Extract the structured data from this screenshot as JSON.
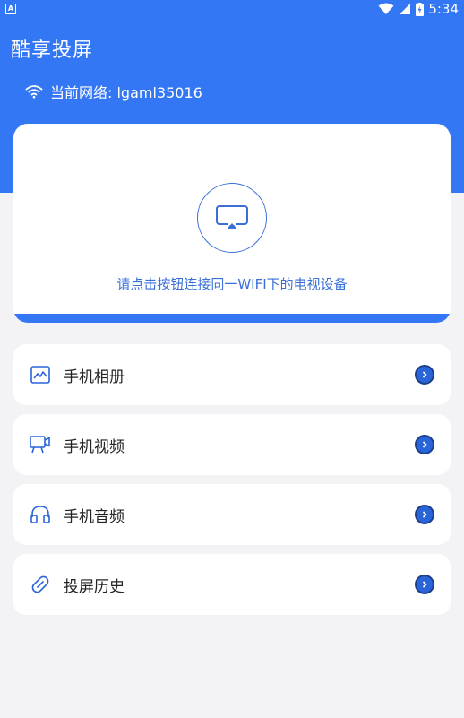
{
  "status_bar": {
    "notification_icon": "A",
    "time": "5:34",
    "icons": [
      "wifi-signal-icon",
      "cell-signal-icon",
      "battery-charging-icon"
    ]
  },
  "app": {
    "title": "酷享投屏"
  },
  "network": {
    "icon": "wifi-icon",
    "label": "当前网络: lgaml35016"
  },
  "cast_card": {
    "button_icon": "screen-cast-icon",
    "hint": "请点击按钮连接同一WIFI下的电视设备"
  },
  "menu": [
    {
      "icon": "photo-album-icon",
      "label": "手机相册"
    },
    {
      "icon": "video-icon",
      "label": "手机视频"
    },
    {
      "icon": "headphones-icon",
      "label": "手机音频"
    },
    {
      "icon": "history-icon",
      "label": "投屏历史"
    }
  ],
  "colors": {
    "primary": "#3377f4",
    "accent_text": "#3a6fd8",
    "background": "#f3f3f5",
    "card": "#ffffff",
    "chevron": "#2a64d9"
  }
}
